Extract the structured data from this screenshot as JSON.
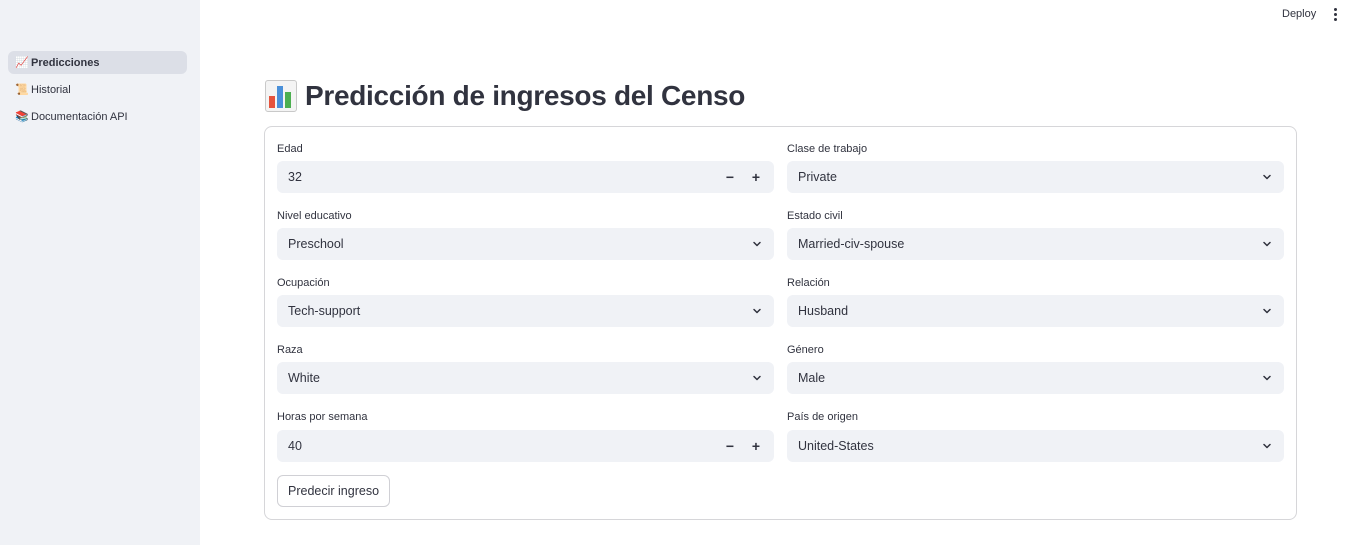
{
  "sidebar": {
    "items": [
      {
        "icon": "chart-increasing-icon",
        "emoji": "📈",
        "label": "Predicciones",
        "active": true
      },
      {
        "icon": "scroll-icon",
        "emoji": "📜",
        "label": "Historial",
        "active": false
      },
      {
        "icon": "books-icon",
        "emoji": "📚",
        "label": "Documentación API",
        "active": false
      }
    ]
  },
  "header": {
    "deploy_label": "Deploy",
    "menu_icon": "vertical-ellipsis-icon"
  },
  "main": {
    "title": "Predicción de ingresos del Censo",
    "title_icon": "bar-chart-icon"
  },
  "form": {
    "fields": [
      {
        "label": "Edad",
        "value": "32",
        "type": "number"
      },
      {
        "label": "Clase de trabajo",
        "value": "Private",
        "type": "select"
      },
      {
        "label": "Nivel educativo",
        "value": "Preschool",
        "type": "select"
      },
      {
        "label": "Estado civil",
        "value": "Married-civ-spouse",
        "type": "select"
      },
      {
        "label": "Ocupación",
        "value": "Tech-support",
        "type": "select"
      },
      {
        "label": "Relación",
        "value": "Husband",
        "type": "select"
      },
      {
        "label": "Raza",
        "value": "White",
        "type": "select"
      },
      {
        "label": "Género",
        "value": "Male",
        "type": "select"
      },
      {
        "label": "Horas por semana",
        "value": "40",
        "type": "number"
      },
      {
        "label": "País de origen",
        "value": "United-States",
        "type": "select"
      }
    ],
    "stepper": {
      "minus": "−",
      "plus": "+"
    },
    "submit_label": "Predecir ingreso"
  },
  "colors": {
    "sidebar_bg": "#f0f2f6",
    "input_bg": "#f0f2f6",
    "text": "#31333f",
    "active_nav_bg": "#dcdfe7"
  }
}
